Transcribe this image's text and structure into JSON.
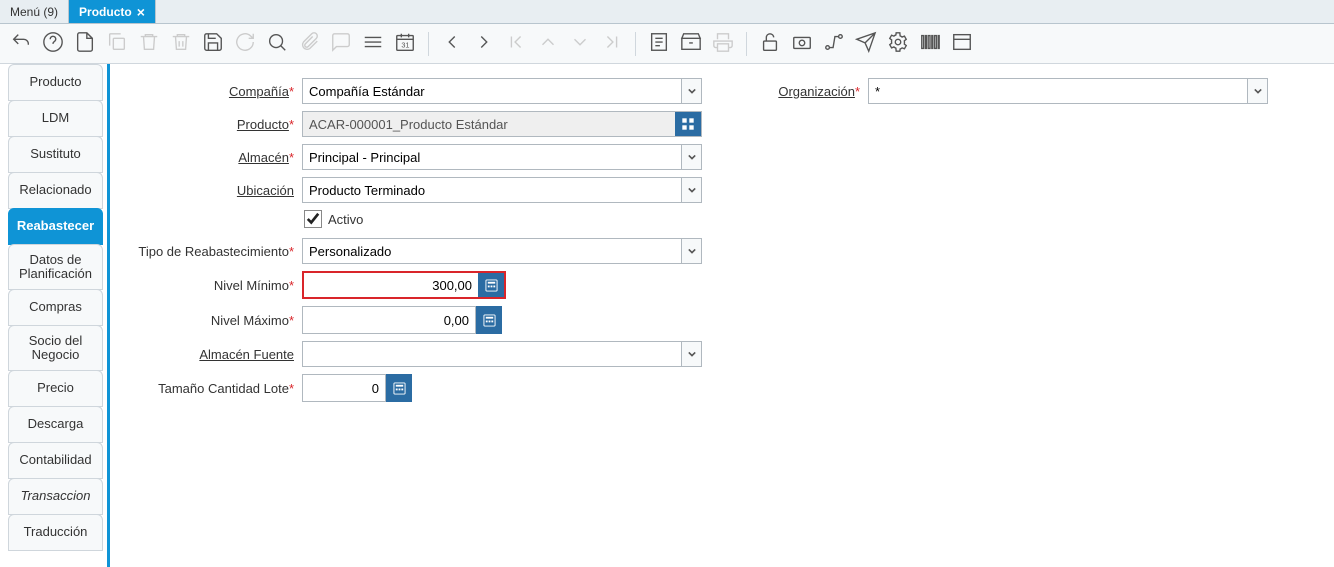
{
  "tabs": {
    "menu": "Menú (9)",
    "active": "Producto"
  },
  "sideTabs": {
    "t0": "Producto",
    "t1": "LDM",
    "t2": "Sustituto",
    "t3": "Relacionado",
    "t4": "Reabastecer",
    "t5": "Datos de Planificación",
    "t6": "Compras",
    "t7": "Socio del Negocio",
    "t8": "Precio",
    "t9": "Descarga",
    "t10": "Contabilidad",
    "t11": "Transaccion",
    "t12": "Traducción"
  },
  "labels": {
    "compania": "Compañía",
    "organizacion": "Organización",
    "producto": "Producto",
    "almacen": "Almacén",
    "ubicacion": "Ubicación",
    "activo": "Activo",
    "tipoReabast": "Tipo de Reabastecimiento",
    "nivelMin": "Nivel Mínimo",
    "nivelMax": "Nivel Máximo",
    "almacenFuente": "Almacén Fuente",
    "tamanoLote": "Tamaño Cantidad Lote"
  },
  "values": {
    "compania": "Compañía Estándar",
    "organizacion": "*",
    "producto": "ACAR-000001_Producto Estándar",
    "almacen": "Principal - Principal",
    "ubicacion": "Producto Terminado",
    "tipoReabast": "Personalizado",
    "nivelMin": "300,00",
    "nivelMax": "0,00",
    "almacenFuente": "",
    "tamanoLote": "0"
  }
}
